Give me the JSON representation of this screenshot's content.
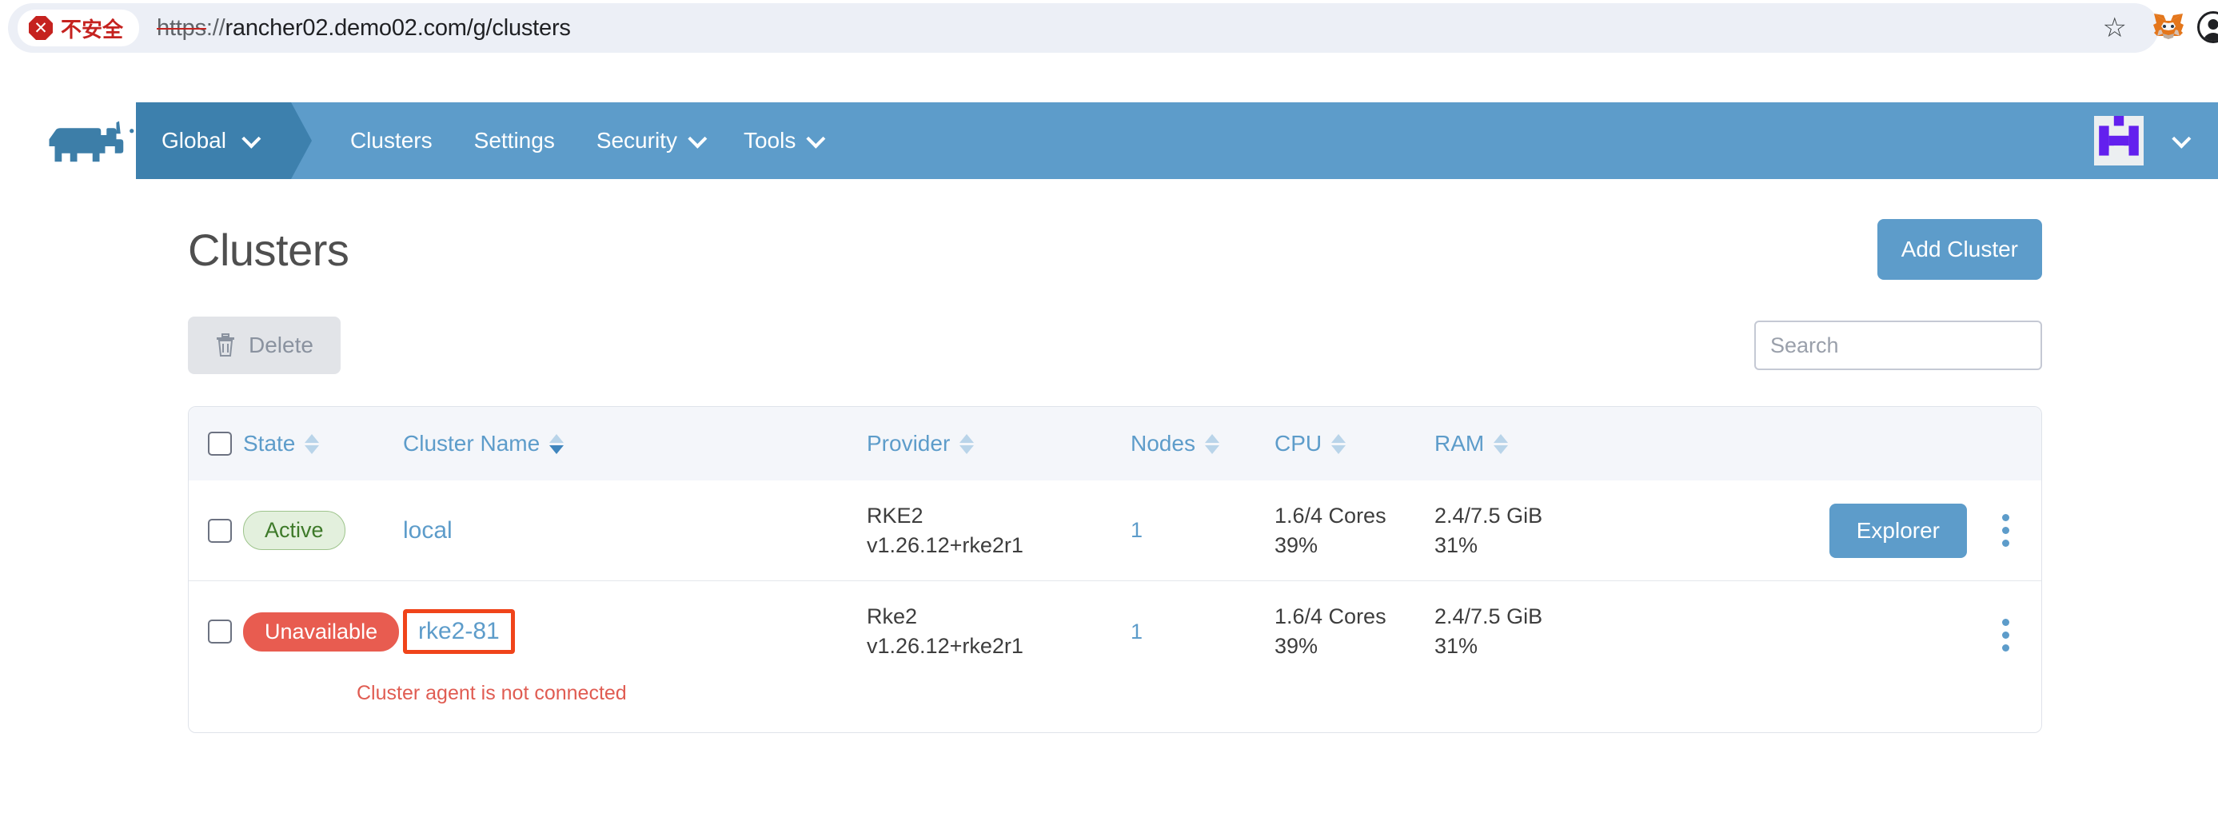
{
  "browser": {
    "security_label": "不安全",
    "security_icon": "warning-octagon-icon",
    "url_scheme": "https",
    "url_separator": "://",
    "url_rest": "rancher02.demo02.com/g/clusters",
    "star_glyph": "☆"
  },
  "nav": {
    "logo": "rancher-logo",
    "context_label": "Global",
    "items": [
      {
        "label": "Clusters",
        "has_caret": false
      },
      {
        "label": "Settings",
        "has_caret": false
      },
      {
        "label": "Security",
        "has_caret": true
      },
      {
        "label": "Tools",
        "has_caret": true
      }
    ],
    "avatar": "user-avatar-identicon"
  },
  "header": {
    "title": "Clusters",
    "add_cluster_label": "Add Cluster"
  },
  "toolbar": {
    "delete_label": "Delete",
    "search_placeholder": "Search",
    "search_value": ""
  },
  "table": {
    "columns": [
      {
        "key": "state",
        "label": "State",
        "sorted": false
      },
      {
        "key": "name",
        "label": "Cluster Name",
        "sorted": true
      },
      {
        "key": "provider",
        "label": "Provider",
        "sorted": false
      },
      {
        "key": "nodes",
        "label": "Nodes",
        "sorted": false
      },
      {
        "key": "cpu",
        "label": "CPU",
        "sorted": false
      },
      {
        "key": "ram",
        "label": "RAM",
        "sorted": false
      }
    ],
    "rows": [
      {
        "state": "Active",
        "state_kind": "active",
        "name": "local",
        "highlighted": false,
        "provider_name": "RKE2",
        "provider_version": "v1.26.12+rke2r1",
        "nodes": "1",
        "cpu_value": "1.6/4 Cores",
        "cpu_percent": "39%",
        "ram_value": "2.4/7.5 GiB",
        "ram_percent": "31%",
        "explorer_label": "Explorer",
        "has_explorer": true,
        "error": ""
      },
      {
        "state": "Unavailable",
        "state_kind": "unavailable",
        "name": "rke2-81",
        "highlighted": true,
        "provider_name": "Rke2",
        "provider_version": "v1.26.12+rke2r1",
        "nodes": "1",
        "cpu_value": "1.6/4 Cores",
        "cpu_percent": "39%",
        "ram_value": "2.4/7.5 GiB",
        "ram_percent": "31%",
        "explorer_label": "",
        "has_explorer": false,
        "error": "Cluster agent is not connected"
      }
    ]
  },
  "colors": {
    "nav_bg": "#5d9cca",
    "nav_context_bg": "#3d80ad",
    "primary": "#5d9cca",
    "danger": "#e85c50",
    "success": "#3e7a2a",
    "highlight_box": "#f0441a",
    "insecure": "#c5221f"
  }
}
